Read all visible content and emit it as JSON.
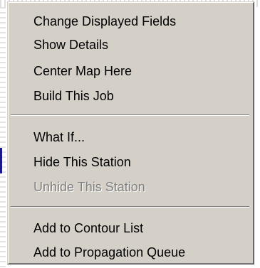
{
  "context_menu": {
    "groups": [
      {
        "items": [
          {
            "label": "Change Displayed Fields",
            "enabled": true
          },
          {
            "label": "Show Details",
            "enabled": true
          },
          {
            "label": "Center Map Here",
            "enabled": true
          },
          {
            "label": "Build This Job",
            "enabled": true
          }
        ]
      },
      {
        "items": [
          {
            "label": "What If...",
            "enabled": true
          },
          {
            "label": "Hide This Station",
            "enabled": true
          },
          {
            "label": "Unhide This Station",
            "enabled": false
          }
        ]
      },
      {
        "items": [
          {
            "label": "Add to Contour List",
            "enabled": true
          },
          {
            "label": "Add to Propagation Queue",
            "enabled": true
          }
        ]
      }
    ]
  },
  "colors": {
    "menu_background": "#d4d0c8",
    "text": "#000000",
    "disabled_text": "#808080",
    "separator_dark": "#808080",
    "separator_light": "#ffffff"
  }
}
